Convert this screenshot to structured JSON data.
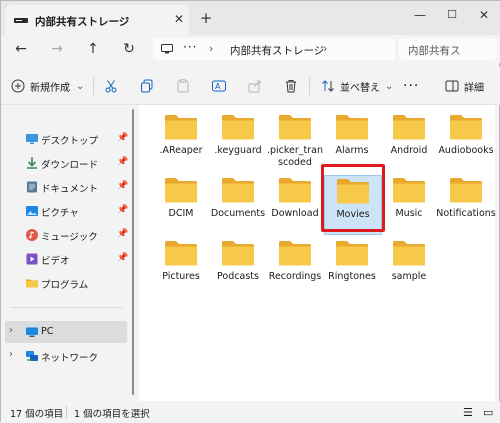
{
  "tab": {
    "title": "内部共有ストレージ"
  },
  "address": {
    "path": "内部共有ストレージ",
    "search_placeholder": "内部共有ス"
  },
  "commandbar": {
    "new_label": "新規作成",
    "sort_label": "並べ替え",
    "details_label": "詳細"
  },
  "sidebar": {
    "items": [
      {
        "label": "デスクトップ",
        "icon": "desktop-icon"
      },
      {
        "label": "ダウンロード",
        "icon": "download-icon"
      },
      {
        "label": "ドキュメント",
        "icon": "document-icon"
      },
      {
        "label": "ピクチャ",
        "icon": "pictures-icon"
      },
      {
        "label": "ミュージック",
        "icon": "music-icon"
      },
      {
        "label": "ビデオ",
        "icon": "video-icon"
      },
      {
        "label": "プログラム",
        "icon": "folder-icon"
      }
    ],
    "pc_label": "PC",
    "network_label": "ネットワーク"
  },
  "folders": [
    {
      "name": ".AReaper"
    },
    {
      "name": ".keyguard"
    },
    {
      "name": ".picker_transcoded"
    },
    {
      "name": "Alarms"
    },
    {
      "name": "Android"
    },
    {
      "name": "Audiobooks"
    },
    {
      "name": "DCIM"
    },
    {
      "name": "Documents"
    },
    {
      "name": "Download"
    },
    {
      "name": "Movies"
    },
    {
      "name": "Music"
    },
    {
      "name": "Notifications"
    },
    {
      "name": "Pictures"
    },
    {
      "name": "Podcasts"
    },
    {
      "name": "Recordings"
    },
    {
      "name": "Ringtones"
    },
    {
      "name": "sample"
    }
  ],
  "status": {
    "count": "17 個の項目",
    "selected": "1 個の項目を選択"
  },
  "colors": {
    "folder": "#f7c948",
    "selection": "#cce4f7",
    "highlight": "#e0191c"
  }
}
